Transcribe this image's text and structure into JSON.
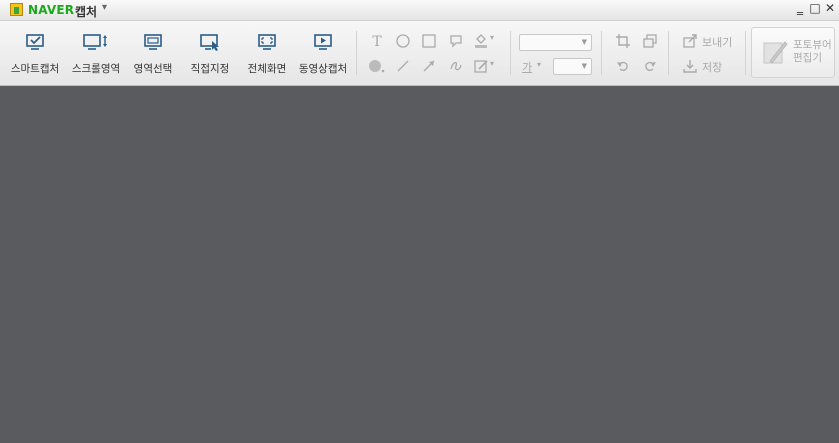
{
  "titlebar": {
    "brand": "NAVER",
    "app_name": "캡처",
    "dropdown_glyph": "▾",
    "controls": {
      "minimize": "‗",
      "maximize": "□",
      "close": "✕"
    }
  },
  "capture_buttons": [
    {
      "label": "스마트캡처",
      "icon": "smart-capture-icon"
    },
    {
      "label": "스크롤영역",
      "icon": "scroll-capture-icon"
    },
    {
      "label": "영역선택",
      "icon": "region-select-icon"
    },
    {
      "label": "직접지정",
      "icon": "manual-select-icon"
    },
    {
      "label": "전체화면",
      "icon": "fullscreen-icon"
    },
    {
      "label": "동영상캡처",
      "icon": "video-capture-icon"
    }
  ],
  "draw_tools": {
    "text_glyph": "T",
    "text_size_label": "가",
    "text_size_arrow": "▾",
    "fill_arrow": "▾",
    "pen_arrow": "▾"
  },
  "actions": {
    "send": "보내기",
    "save": "저장"
  },
  "editor": {
    "line1": "포토뷰어",
    "line2": "편집기"
  },
  "colors": {
    "brand_green": "#1ba81b",
    "canvas": "#5a5b5f",
    "icon_blue": "#2a5d8a"
  }
}
